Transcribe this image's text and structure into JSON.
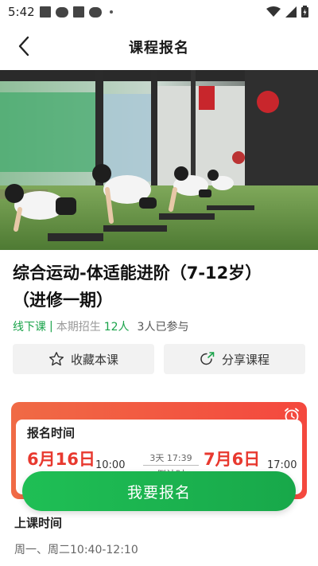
{
  "status_bar": {
    "time": "5:42"
  },
  "nav": {
    "title": "课程报名"
  },
  "course": {
    "title_line1": "综合运动-体适能进阶（7-12岁）",
    "title_line2": "（进修一期）",
    "type": "线下课",
    "separator": "|",
    "enroll_label": "本期招生",
    "enroll_count": "12人",
    "joined": "3人已参与"
  },
  "actions": {
    "favorite": "收藏本课",
    "share": "分享课程"
  },
  "registration": {
    "label": "报名时间",
    "start_date": "6月16日",
    "start_time": "10:00",
    "duration": "3天 17:39",
    "status": "倒计时",
    "end_date": "7月6日",
    "end_time": "17:00"
  },
  "enroll_button": "我要报名",
  "class_time": {
    "label": "上课时间",
    "value": "周一、周二10:40-12:10"
  },
  "colors": {
    "green": "#1aa34a",
    "red": "#e8392f",
    "card_orange": "#f06a45"
  }
}
